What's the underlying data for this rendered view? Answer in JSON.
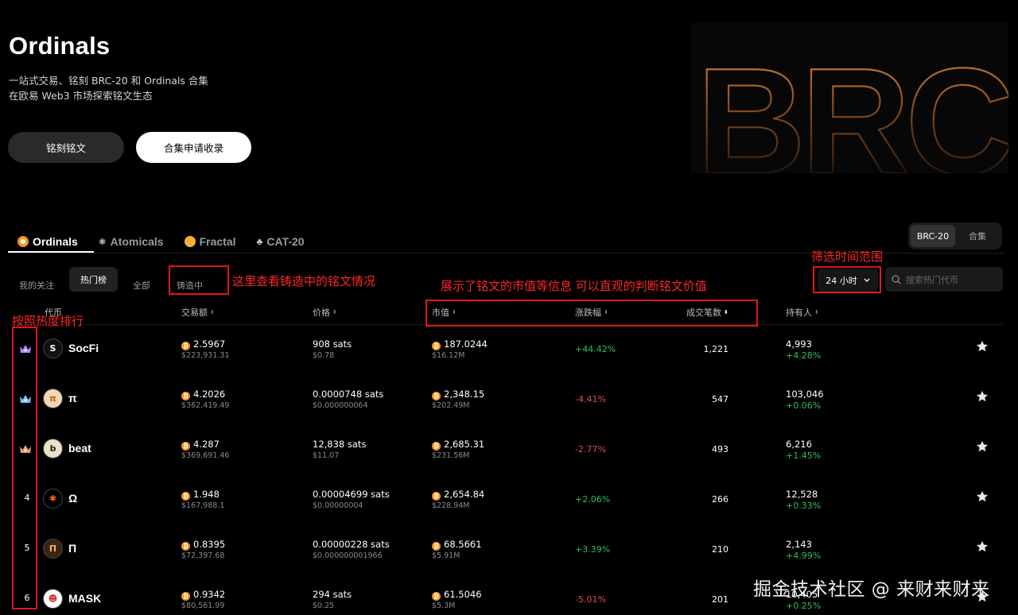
{
  "hero": {
    "title": "Ordinals",
    "subtitle_1": "一站式交易、铭刻 BRC-20 和 Ordinals 合集",
    "subtitle_2": "在欧易 Web3 市场探索铭文生态",
    "btn_inscribe": "铭刻铭文",
    "btn_apply": "合集申请收录",
    "art_text": "BRC"
  },
  "protocol_tabs": [
    {
      "label": "Ordinals",
      "icon": "ordinals-icon"
    },
    {
      "label": "Atomicals",
      "icon": "atomicals-icon"
    },
    {
      "label": "Fractal",
      "icon": "fractal-icon"
    },
    {
      "label": "CAT-20",
      "icon": "cat20-icon"
    }
  ],
  "segment": {
    "brc20": "BRC-20",
    "collection": "合集"
  },
  "filters": {
    "following": "我的关注",
    "hot": "热门榜",
    "all": "全部",
    "minting": "铸造中",
    "time": "24 小时",
    "search_placeholder": "搜索热门代币"
  },
  "annotations": {
    "minting_note": "这里查看铸造中的铭文情况",
    "market_note": "展示了铭文的市值等信息 可以直观的判断铭文价值",
    "time_note": "筛选时间范围",
    "rank_note": "按照热度排行"
  },
  "columns": {
    "token": "代币",
    "volume": "交易额",
    "price": "价格",
    "mcap": "市值",
    "change": "涨跌幅",
    "txns": "成交笔数",
    "holders": "持有人"
  },
  "rows": [
    {
      "rank": "",
      "rank_icon": "crown-purple-icon",
      "avatar": "S",
      "avatar_bg": "#111111",
      "avatar_fg": "#ffffff",
      "name": "SocFi",
      "vol_btc": "2.5967",
      "vol_usd": "$223,931.31",
      "price": "908 sats",
      "price_usd": "$0.78",
      "mcap_btc": "187.0244",
      "mcap_usd": "$16.12M",
      "change": "+44.42%",
      "change_dir": "pos",
      "txns": "1,221",
      "holders": "4,993",
      "holders_chg": "+4.28%",
      "holders_dir": "pos"
    },
    {
      "rank": "",
      "rank_icon": "crown-blue-icon",
      "avatar": "π",
      "avatar_bg": "#f4d6b8",
      "avatar_fg": "#c55a11",
      "name": "π",
      "vol_btc": "4.2026",
      "vol_usd": "$362,419.49",
      "price": "0.0000748 sats",
      "price_usd": "$0.000000064",
      "mcap_btc": "2,348.15",
      "mcap_usd": "$202.49M",
      "change": "-4.41%",
      "change_dir": "neg",
      "txns": "547",
      "holders": "103,046",
      "holders_chg": "+0.06%",
      "holders_dir": "pos"
    },
    {
      "rank": "",
      "rank_icon": "crown-bronze-icon",
      "avatar": "b",
      "avatar_bg": "#e8e2c8",
      "avatar_fg": "#222222",
      "name": "beat",
      "vol_btc": "4.287",
      "vol_usd": "$369,691.46",
      "price": "12,838 sats",
      "price_usd": "$11.07",
      "mcap_btc": "2,685.31",
      "mcap_usd": "$231.56M",
      "change": "-2.77%",
      "change_dir": "neg",
      "txns": "493",
      "holders": "6,216",
      "holders_chg": "+1.45%",
      "holders_dir": "pos"
    },
    {
      "rank": "4",
      "rank_icon": "",
      "avatar": "✱",
      "avatar_bg": "#000000",
      "avatar_fg": "#f26522",
      "name": "Ω",
      "vol_btc": "1.948",
      "vol_usd": "$167,988.1",
      "price": "0.00004699 sats",
      "price_usd": "$0.00000004",
      "mcap_btc": "2,654.84",
      "mcap_usd": "$228.94M",
      "change": "+2.06%",
      "change_dir": "pos",
      "txns": "266",
      "holders": "12,528",
      "holders_chg": "+0.33%",
      "holders_dir": "pos"
    },
    {
      "rank": "5",
      "rank_icon": "",
      "avatar": "Π",
      "avatar_bg": "#3a2412",
      "avatar_fg": "#f0b36b",
      "name": "Π",
      "vol_btc": "0.8395",
      "vol_usd": "$72,397.68",
      "price": "0.00000228 sats",
      "price_usd": "$0.000000001966",
      "mcap_btc": "68.5661",
      "mcap_usd": "$5.91M",
      "change": "+3.39%",
      "change_dir": "pos",
      "txns": "210",
      "holders": "2,143",
      "holders_chg": "+4.99%",
      "holders_dir": "pos"
    },
    {
      "rank": "6",
      "rank_icon": "",
      "avatar": "☻",
      "avatar_bg": "#ffffff",
      "avatar_fg": "#d4312b",
      "name": "MASK",
      "vol_btc": "0.9342",
      "vol_usd": "$80,561.99",
      "price": "294 sats",
      "price_usd": "$0.25",
      "mcap_btc": "61.5046",
      "mcap_usd": "$5.3M",
      "change": "-5.01%",
      "change_dir": "neg",
      "txns": "201",
      "holders": "10,405",
      "holders_chg": "+0.25%",
      "holders_dir": "pos"
    }
  ],
  "watermark": "掘金技术社区 @ 来财来财来",
  "colors": {
    "accent_orange": "#f7931a",
    "positive": "#2ebd5f",
    "negative": "#e04b58",
    "annotation_red": "#e0161b"
  }
}
